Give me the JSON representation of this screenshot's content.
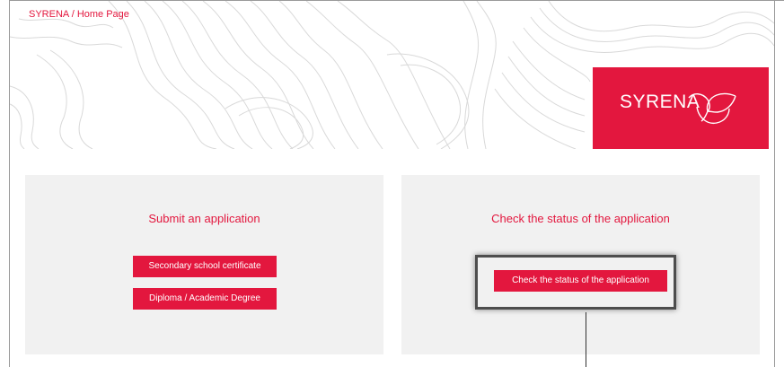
{
  "breadcrumb": {
    "home": "SYRENA",
    "separator": " / ",
    "current": "Home Page"
  },
  "logo": {
    "text": "SYRENA",
    "icon": "syrena-leaf-icon"
  },
  "submit_card": {
    "title": "Submit an application",
    "buttons": [
      {
        "label": "Secondary school certificate"
      },
      {
        "label": "Diploma / Academic Degree"
      }
    ]
  },
  "status_card": {
    "title": "Check the status of the application",
    "button_label": "Check the status of the application"
  },
  "colors": {
    "accent": "#e3173e",
    "card_background": "#f1f1f1",
    "highlight_border": "#4d4d4d"
  }
}
